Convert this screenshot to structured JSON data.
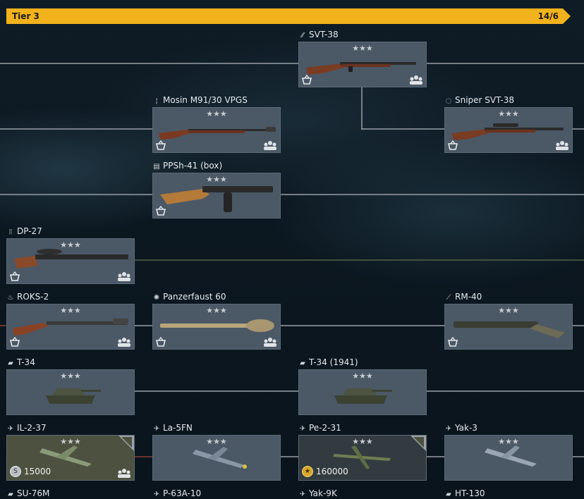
{
  "tier": {
    "label": "Tier 3",
    "count": "14/6"
  },
  "colors": {
    "tier_bar": "#f2b21c",
    "card_bg": "#4b5866",
    "line": "#8a9196"
  },
  "cards": {
    "svt38": {
      "name": "SVT-38",
      "icon": "rifle-icon",
      "stars": "★★★"
    },
    "mosin": {
      "name": "Mosin M91/30 VPGS",
      "icon": "bolt-action-icon",
      "stars": "★★★"
    },
    "sniper_svt": {
      "name": "Sniper SVT-38",
      "icon": "scope-icon",
      "stars": "★★★"
    },
    "ppsh": {
      "name": "PPSh-41 (box)",
      "icon": "smg-icon",
      "stars": "★★★"
    },
    "dp27": {
      "name": "DP-27",
      "icon": "machine-gun-icon",
      "stars": "★★★"
    },
    "roks": {
      "name": "ROKS-2",
      "icon": "flamethrower-icon",
      "stars": "★★★"
    },
    "panzerfaust": {
      "name": "Panzerfaust 60",
      "icon": "explosive-icon",
      "stars": "★★★"
    },
    "rm40": {
      "name": "RM-40",
      "icon": "mortar-icon",
      "stars": "★★★"
    },
    "t34": {
      "name": "T-34",
      "icon": "tank-icon",
      "stars": "★★★"
    },
    "t34_1941": {
      "name": "T-34 (1941)",
      "icon": "tank-icon",
      "stars": "★★★"
    },
    "il2": {
      "name": "IL-2-37",
      "icon": "plane-icon",
      "stars": "★★★",
      "price": "15000",
      "currency": "S"
    },
    "la5fn": {
      "name": "La-5FN",
      "icon": "plane-icon",
      "stars": "★★★"
    },
    "pe2": {
      "name": "Pe-2-31",
      "icon": "plane-icon",
      "stars": "★★★",
      "price": "160000",
      "currency": "★"
    },
    "yak3": {
      "name": "Yak-3",
      "icon": "plane-icon",
      "stars": "★★★"
    },
    "su76m": {
      "name": "SU-76M",
      "icon": "tank-icon"
    },
    "p63": {
      "name": "P-63A-10",
      "icon": "plane-icon"
    },
    "yak9k": {
      "name": "Yak-9K",
      "icon": "plane-icon"
    },
    "ht130": {
      "name": "HT-130",
      "icon": "tank-icon"
    }
  }
}
